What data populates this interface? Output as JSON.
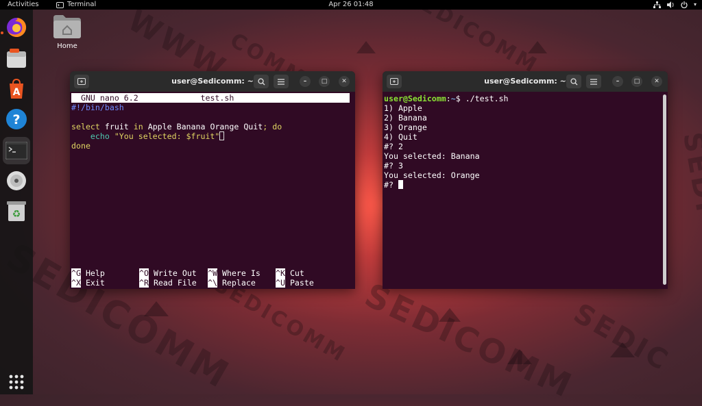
{
  "topbar": {
    "activities": "Activities",
    "app_name": "Terminal",
    "clock": "Apr 26  01:48"
  },
  "dock": {
    "items": [
      "firefox-icon",
      "files-icon",
      "app-center-icon",
      "help-icon",
      "terminal-icon",
      "disc-icon",
      "trash-icon",
      "show-apps-icon"
    ]
  },
  "desktop": {
    "home_label": "Home"
  },
  "left_terminal": {
    "title": "user@Sedicomm: ~",
    "nano_header_app": "GNU nano 6.2",
    "nano_header_file": "test.sh",
    "lines": {
      "shebang": "#!/bin/bash",
      "select_kw": "select",
      "fruit_var": "fruit",
      "in_kw": "in",
      "options": "Apple Banana Orange Quit",
      "semicolon": ";",
      "do_kw": "do",
      "echo_kw": "echo",
      "echo_str": "\"You selected: $fruit\"",
      "done_kw": "done"
    },
    "shortcuts": [
      {
        "key": "^G",
        "label": "Help"
      },
      {
        "key": "^O",
        "label": "Write Out"
      },
      {
        "key": "^W",
        "label": "Where Is"
      },
      {
        "key": "^K",
        "label": "Cut"
      },
      {
        "key": "^X",
        "label": "Exit"
      },
      {
        "key": "^R",
        "label": "Read File"
      },
      {
        "key": "^\\",
        "label": "Replace"
      },
      {
        "key": "^U",
        "label": "Paste"
      }
    ]
  },
  "right_terminal": {
    "title": "user@Sedicomm: ~",
    "prompt_user": "user@Sedicomm",
    "prompt_colon": ":",
    "prompt_path": "~",
    "prompt_dollar": "$",
    "command": "./test.sh",
    "output": [
      "1) Apple",
      "2) Banana",
      "3) Orange",
      "4) Quit",
      "#? 2",
      "You selected: Banana",
      "#? 3",
      "You selected: Orange"
    ],
    "final_prompt": "#? "
  },
  "colors": {
    "terminal_bg": "#300a24",
    "titlebar_bg": "#2b2b2b",
    "accent": "#e95420"
  }
}
